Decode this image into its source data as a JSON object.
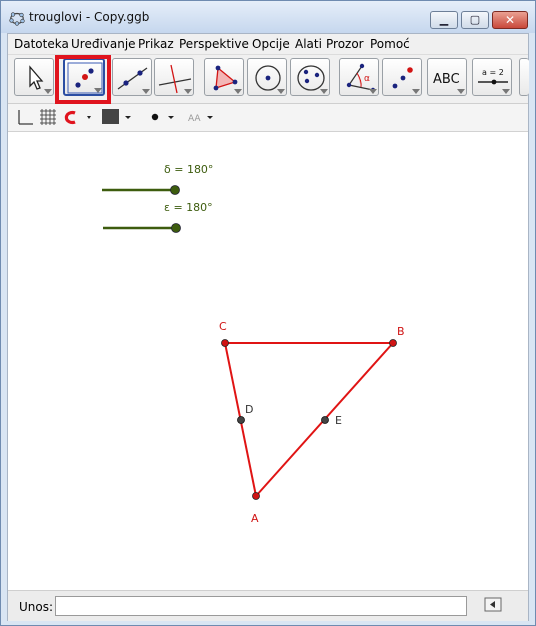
{
  "window": {
    "title": "trouglovi - Copy.ggb",
    "controls": [
      "minimize",
      "maximize",
      "close"
    ]
  },
  "menu": [
    "Datoteka",
    "Uređivanje",
    "Prikaz",
    "Perspektive",
    "Opcije",
    "Alati",
    "Prozor",
    "Pomoć"
  ],
  "toolbar": {
    "tools": [
      "move-tool",
      "point-tool",
      "line-tool",
      "perpendicular-tool",
      "polygon-tool",
      "circle-tool",
      "conic-tool",
      "angle-tool",
      "reflect-tool",
      "text-tool",
      "slider-tool"
    ],
    "selected": "point-tool",
    "text_tool_label": "ABC",
    "slider_tool_label": "a = 2"
  },
  "stylebar": {
    "icons": [
      "axes-icon",
      "grid-icon",
      "magnet-icon",
      "color-swatch",
      "point-style-icon",
      "label-style-icon"
    ],
    "label_style_text": "AA"
  },
  "graphics": {
    "sliders": [
      {
        "label": "δ = 180°",
        "color": "#3d5c0e"
      },
      {
        "label": "ε = 180°",
        "color": "#3d5c0e"
      }
    ],
    "points": [
      {
        "name": "A",
        "color": "#d01414"
      },
      {
        "name": "B",
        "color": "#d01414"
      },
      {
        "name": "C",
        "color": "#d01414"
      },
      {
        "name": "D",
        "color": "#333333"
      },
      {
        "name": "E",
        "color": "#333333"
      }
    ],
    "triangle_color": "#e01414"
  },
  "inputbar": {
    "label": "Unos:",
    "value": ""
  }
}
